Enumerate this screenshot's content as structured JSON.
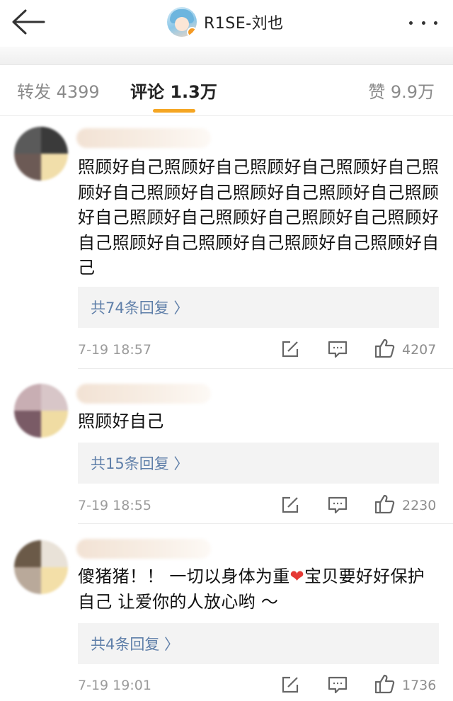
{
  "header": {
    "title": "R1SE-刘也",
    "back_icon": "back-arrow-icon",
    "more_icon": "more-dots-icon"
  },
  "tabs": {
    "reposts": "转发 4399",
    "comments": "评论 1.3万",
    "likes": "赞 9.9万",
    "active": "comments",
    "accent_color": "#f5a623"
  },
  "comments": [
    {
      "text": "照顾好自己照顾好自己照顾好自己照顾好自己照顾好自己照顾好自己照顾好自己照顾好自己照顾好自己照顾好自己照顾好自己照顾好自己照顾好自己照顾好自己照顾好自己照顾好自己照顾好自己",
      "replies": "共74条回复 〉",
      "time": "7-19 18:57",
      "likes": "4207"
    },
    {
      "text": "照顾好自己",
      "replies": "共15条回复 〉",
      "time": "7-19 18:55",
      "likes": "2230"
    },
    {
      "text_before": "傻猪猪！！ 一切以身体为重",
      "emoji": "❤",
      "text_after": "宝贝要好好保护自己 让爱你的人放心哟 ～",
      "replies": "共4条回复 〉",
      "time": "7-19 19:01",
      "likes": "1736"
    }
  ],
  "colors": {
    "reply_link": "#5f7fa9",
    "meta_gray": "#9b9b9b"
  }
}
